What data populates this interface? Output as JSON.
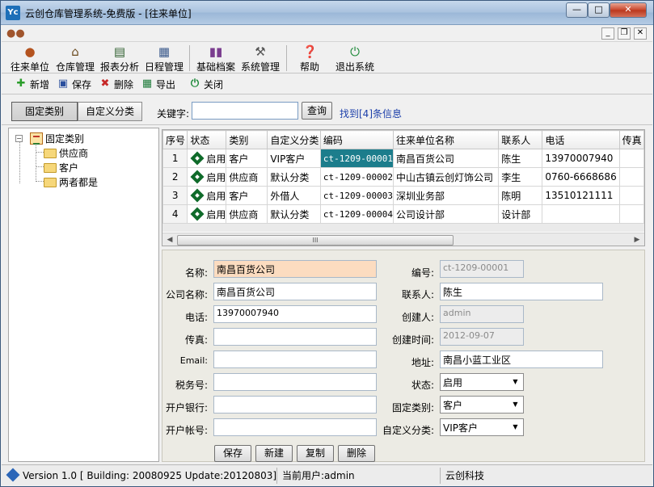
{
  "window": {
    "title": "云创仓库管理系统-免费版 - [往来单位]",
    "icon_text": "Yc",
    "controls": {
      "minimize": "—",
      "maximize": "□",
      "close": "✕"
    }
  },
  "mdi": {
    "minimize": "_",
    "restore": "❐",
    "close": "✕"
  },
  "main_toolbar": [
    {
      "label": "往来单位",
      "icon": "contacts-icon"
    },
    {
      "label": "仓库管理",
      "icon": "house-icon"
    },
    {
      "label": "报表分析",
      "icon": "report-icon"
    },
    {
      "label": "日程管理",
      "icon": "calendar-icon"
    },
    {
      "label": "基础档案",
      "icon": "books-icon"
    },
    {
      "label": "系统管理",
      "icon": "tools-icon"
    },
    {
      "label": "帮助",
      "icon": "help-icon"
    },
    {
      "label": "退出系统",
      "icon": "exit-icon"
    }
  ],
  "actions": {
    "new": "新增",
    "save": "保存",
    "delete": "删除",
    "export": "导出",
    "close": "关闭"
  },
  "filter": {
    "fixed_category": "固定类别",
    "custom_category": "自定义分类",
    "keyword_label": "关键字:",
    "keyword_value": "",
    "search": "查询",
    "found": "找到[4]条信息"
  },
  "tree": {
    "root": "固定类别",
    "children": [
      "供应商",
      "客户",
      "两者都是"
    ]
  },
  "grid": {
    "columns": [
      "序号",
      "状态",
      "类别",
      "自定义分类",
      "编码",
      "往来单位名称",
      "联系人",
      "电话",
      "传真"
    ],
    "rows": [
      {
        "no": "1",
        "status": "启用",
        "category": "客户",
        "custom": "VIP客户",
        "code": "ct-1209-00001",
        "name": "南昌百货公司",
        "contact": "陈生",
        "phone": "13970007940",
        "fax": ""
      },
      {
        "no": "2",
        "status": "启用",
        "category": "供应商",
        "custom": "默认分类",
        "code": "ct-1209-00002",
        "name": "中山古镇云创灯饰公司",
        "contact": "李生",
        "phone": "0760-6668686",
        "fax": ""
      },
      {
        "no": "3",
        "status": "启用",
        "category": "客户",
        "custom": "外借人",
        "code": "ct-1209-00003",
        "name": "深圳业务部",
        "contact": "陈明",
        "phone": "13510121111",
        "fax": ""
      },
      {
        "no": "4",
        "status": "启用",
        "category": "供应商",
        "custom": "默认分类",
        "code": "ct-1209-00004",
        "name": "公司设计部",
        "contact": "设计部",
        "phone": "",
        "fax": ""
      }
    ],
    "scroll_grip": "III"
  },
  "form": {
    "labels": {
      "name": "名称:",
      "company": "公司名称:",
      "phone": "电话:",
      "fax": "传真:",
      "email": "Email:",
      "tax": "税务号:",
      "bank": "开户银行:",
      "account": "开户帐号:",
      "code": "编号:",
      "contact": "联系人:",
      "creator": "创建人:",
      "created": "创建时间:",
      "address": "地址:",
      "status": "状态:",
      "fixed": "固定类别:",
      "custom": "自定义分类:"
    },
    "values": {
      "name": "南昌百货公司",
      "company": "南昌百货公司",
      "phone": "13970007940",
      "fax": "",
      "email": "",
      "tax": "",
      "bank": "",
      "account": "",
      "code": "ct-1209-00001",
      "contact": "陈生",
      "creator": "admin",
      "created": "2012-09-07",
      "address": "南昌小蓝工业区",
      "status": "启用",
      "fixed": "客户",
      "custom": "VIP客户"
    },
    "buttons": {
      "save": "保存",
      "new": "新建",
      "copy": "复制",
      "delete": "删除"
    }
  },
  "statusbar": {
    "version": "Version 1.0 [ Building: 20080925 Update:20120803]",
    "user": "当前用户:admin",
    "company": "云创科技"
  }
}
